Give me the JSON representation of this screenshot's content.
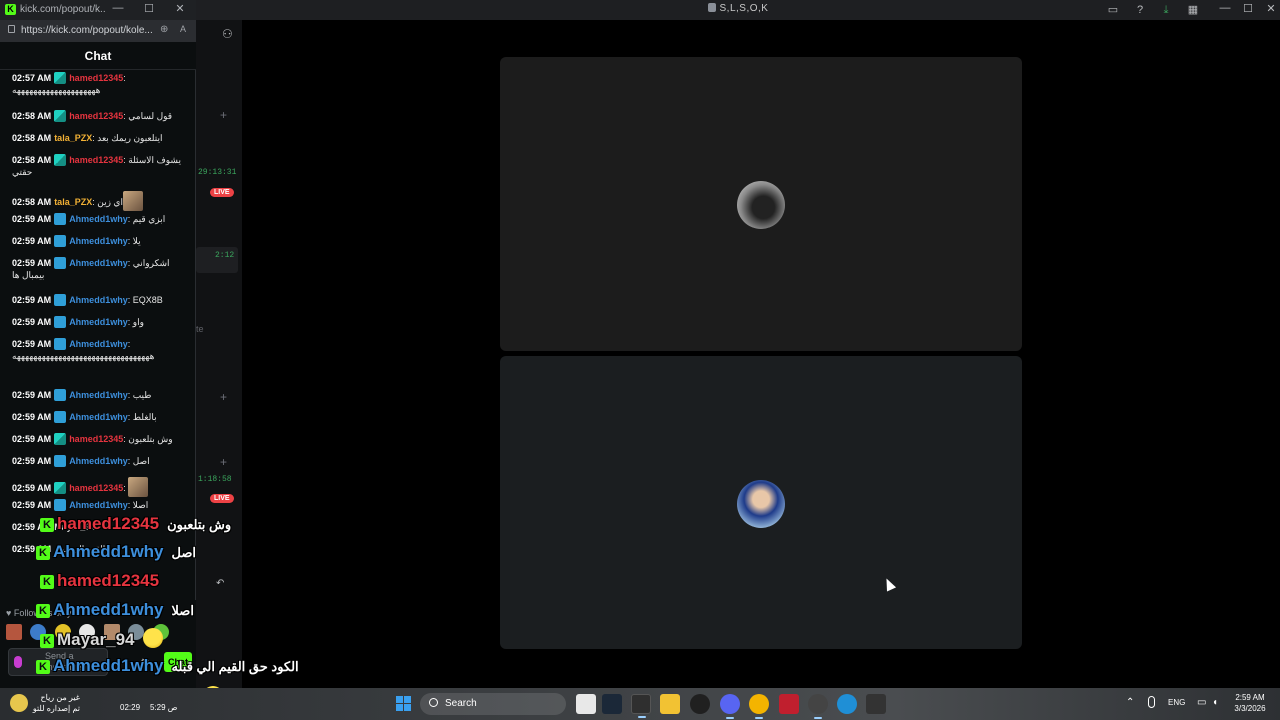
{
  "main_window": {
    "title": "S,L,S,O,K",
    "titlebar_icons": [
      "inbox-icon",
      "help-icon",
      "download-icon",
      "gallery-icon"
    ],
    "controls": {
      "minimize": "—",
      "maximize": "☐",
      "close": "✕"
    },
    "strip_times": [
      "29:13:31",
      "2:12",
      "1:18:58"
    ],
    "live_badge": "LIVE",
    "strip_text": "te"
  },
  "chat_window": {
    "title": "kick.com/popout/k...",
    "url": "https://kick.com/popout/kole...",
    "header_title": "Chat",
    "controls": {
      "minimize": "—",
      "maximize": "☐",
      "close": "✕"
    },
    "messages": [
      {
        "time": "02:57 AM",
        "badge": "sub",
        "user": "hamed12345",
        "user_class": "u-hamed",
        "text": "ههههههههههههههههههههه"
      },
      {
        "time": "02:58 AM",
        "badge": "sub",
        "user": "hamed12345",
        "user_class": "u-hamed",
        "text": "قول لسامي"
      },
      {
        "time": "02:58 AM",
        "badge": "",
        "user": "tala_PZX",
        "user_class": "u-tala",
        "text": "ايتلعبون ريمك بعد"
      },
      {
        "time": "02:58 AM",
        "badge": "sub",
        "user": "hamed12345",
        "user_class": "u-hamed",
        "text": "يشوف الاسئلة حقتي"
      },
      {
        "time": "02:58 AM",
        "badge": "",
        "user": "tala_PZX",
        "user_class": "u-tala",
        "text": "اي زين"
      },
      {
        "time": "02:59 AM",
        "badge": "pick",
        "user": "Ahmedd1why",
        "user_class": "u-ahmed",
        "text": "ابزي قيم"
      },
      {
        "time": "02:59 AM",
        "badge": "pick",
        "user": "Ahmedd1why",
        "user_class": "u-ahmed",
        "text": "يلا"
      },
      {
        "time": "02:59 AM",
        "badge": "pick",
        "user": "Ahmedd1why",
        "user_class": "u-ahmed",
        "text": "اشكرواني بيمبال ها"
      },
      {
        "time": "02:59 AM",
        "badge": "pick",
        "user": "Ahmedd1why",
        "user_class": "u-ahmed",
        "text": "EQX8B"
      },
      {
        "time": "02:59 AM",
        "badge": "pick",
        "user": "Ahmedd1why",
        "user_class": "u-ahmed",
        "text": "واو"
      },
      {
        "time": "02:59 AM",
        "badge": "pick",
        "user": "Ahmedd1why",
        "user_class": "u-ahmed",
        "text": "هههههههههههههههههههههههههههههههههه"
      },
      {
        "time": "02:59 AM",
        "badge": "pick",
        "user": "Ahmedd1why",
        "user_class": "u-ahmed",
        "text": "طيب"
      },
      {
        "time": "02:59 AM",
        "badge": "pick",
        "user": "Ahmedd1why",
        "user_class": "u-ahmed",
        "text": "بالغلط"
      },
      {
        "time": "02:59 AM",
        "badge": "sub",
        "user": "hamed12345",
        "user_class": "u-hamed",
        "text": "وش بتلعبون"
      },
      {
        "time": "02:59 AM",
        "badge": "pick",
        "user": "Ahmedd1why",
        "user_class": "u-ahmed",
        "text": "اصل"
      },
      {
        "time": "02:59 AM",
        "badge": "sub",
        "user": "hamed12345",
        "user_class": "u-hamed",
        "text": ""
      },
      {
        "time": "02:59 AM",
        "badge": "pick",
        "user": "Ahmedd1why",
        "user_class": "u-ahmed",
        "text": "اصلا"
      },
      {
        "time": "02:59 AM",
        "badge": "",
        "user": "Mayar_94",
        "user_class": "u-mayar",
        "text": ""
      },
      {
        "time": "02:59 AM",
        "badge": "",
        "user": "",
        "user_class": "u-mayar",
        "text": "القيم الي قبله"
      }
    ],
    "follow_text": "Followers only",
    "input_placeholder": "Send a message",
    "send_label": "Chat"
  },
  "overlay_chat": [
    {
      "user": "hamed12345",
      "text": "وش بتلعبون",
      "color": "#e5343f",
      "emoji": false
    },
    {
      "user": "Ahmedd1why",
      "text": "اصل",
      "color": "#3d8fdc",
      "emoji": false
    },
    {
      "user": "hamed12345",
      "text": "",
      "color": "#e5343f",
      "emoji": false
    },
    {
      "user": "Ahmedd1why",
      "text": "اصلا",
      "color": "#3d8fdc",
      "emoji": false
    },
    {
      "user": "Mayar_94",
      "text": "",
      "color": "#d8d8d8",
      "emoji": true
    },
    {
      "user": "Ahmedd1why",
      "text": "الكود حق القيم الي قبله",
      "color": "#3d8fdc",
      "emoji": false
    },
    {
      "user": "hamed12345",
      "text": "",
      "color": "#e5343f",
      "emoji": true
    }
  ],
  "taskbar": {
    "weather_line1": "غير من رياح",
    "weather_line2": "تم إصداره للتو",
    "search_label": "Search",
    "lang": "ENG",
    "clock_time": "2:59 AM",
    "clock_date": "3/3/2026",
    "overlay_time_a": "02:29",
    "overlay_time_b": "5:29 ص"
  }
}
